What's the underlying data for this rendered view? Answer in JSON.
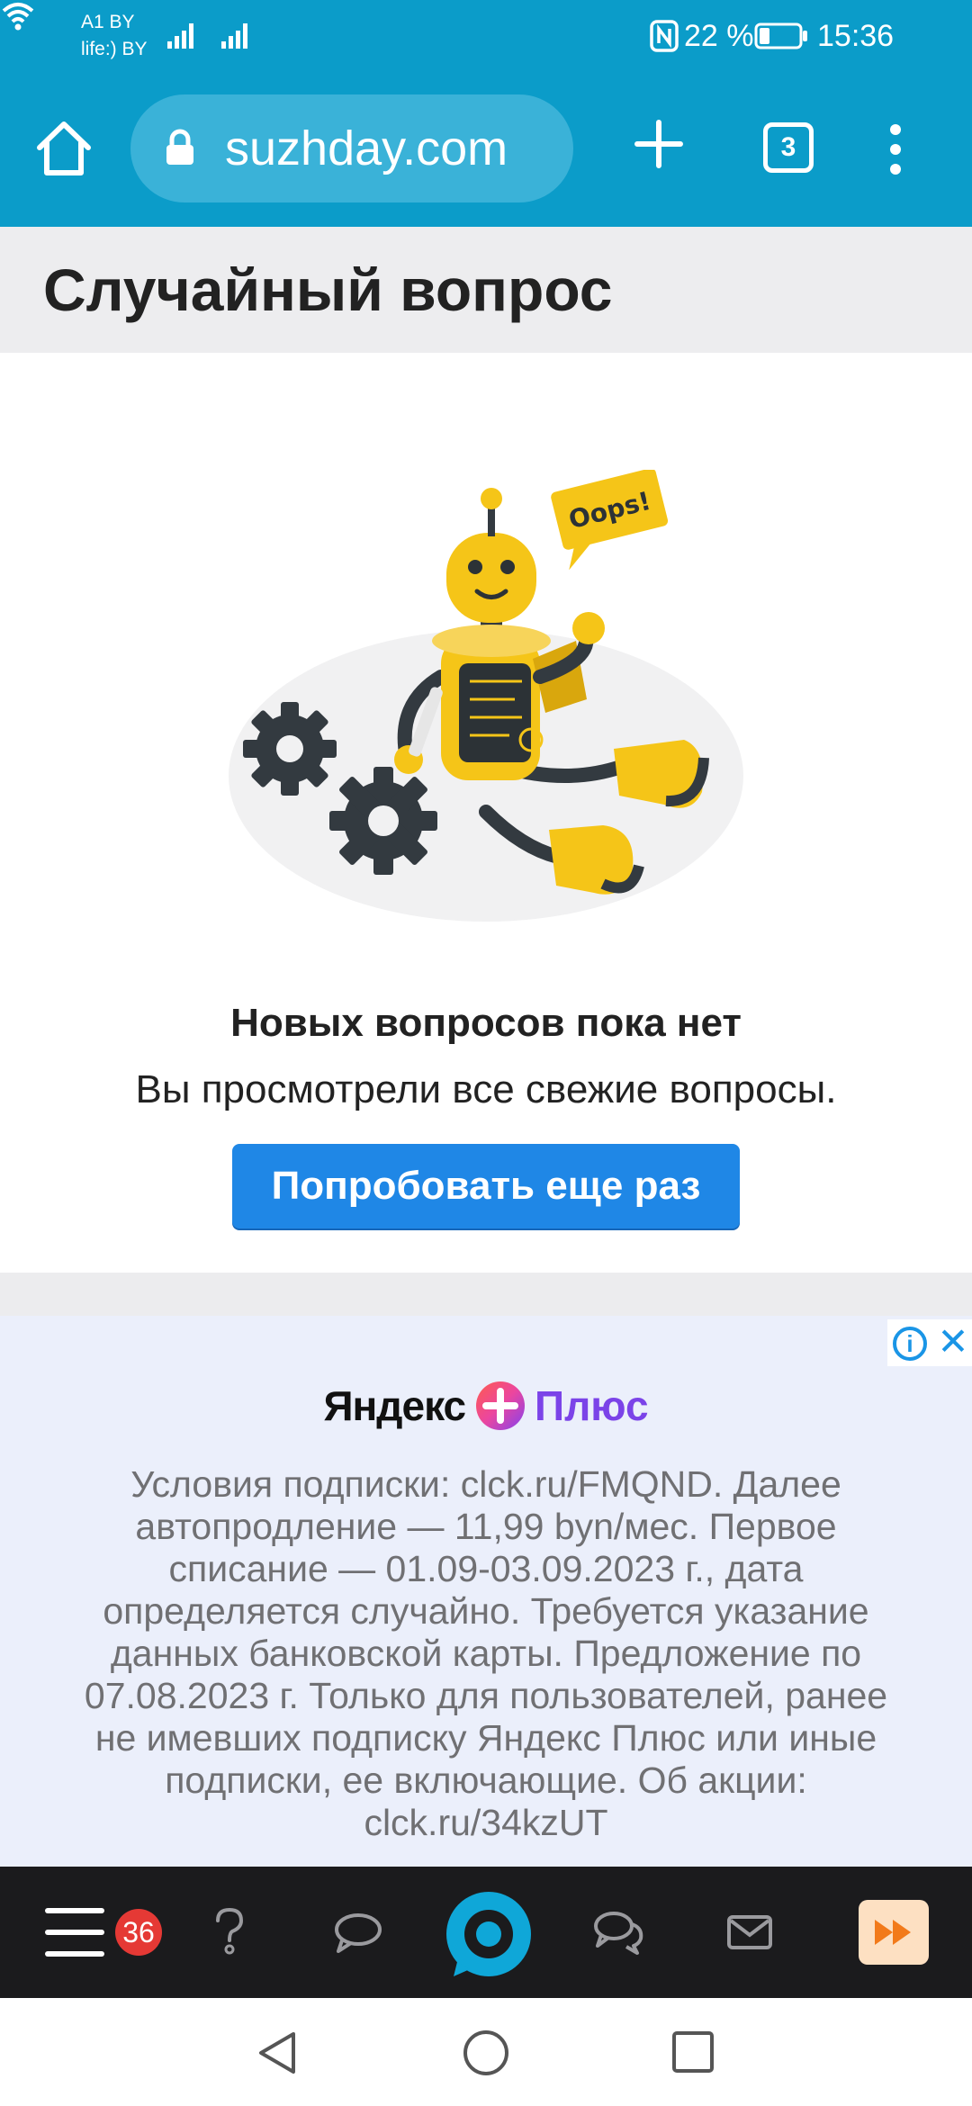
{
  "status_bar": {
    "carrier_1": "A1 BY",
    "carrier_2": "life:) BY",
    "battery_percent": "22 %",
    "time": "15:36"
  },
  "browser": {
    "url": "suzhday.com",
    "tab_count": "3",
    "icons": [
      "home-icon",
      "lock-icon",
      "plus-icon",
      "tabs-icon",
      "more-icon"
    ]
  },
  "page": {
    "title": "Случайный вопрос"
  },
  "empty_state": {
    "illustration_text": "Oops!",
    "title": "Новых вопросов пока нет",
    "subtitle": "Вы просмотрели все свежие вопросы.",
    "retry_button": "Попробовать еще раз"
  },
  "ad": {
    "brand_left": "Яндекс",
    "brand_right": "Плюс",
    "info_icon": "i",
    "close_icon": "✕",
    "text": "Условия подписки: clck.ru/FMQND. Далее автопродление — 11,99 byn/мес. Первое списание — 01.09-03.09.2023 г., дата определяется случайно. Требуется указание данных банковской карты. Предложение по 07.08.2023 г. Только для пользователей, ранее не имевших подписку Яндекс Плюс или иные подписки, ее включающие. Об акции: clck.ru/34kzUT"
  },
  "site_nav": {
    "notification_count": "36",
    "icons": [
      "menu-icon",
      "question-icon",
      "comment-icon",
      "logo-icon",
      "chat-icon",
      "mail-icon",
      "fast-forward-icon"
    ]
  },
  "system_nav": {
    "icons": [
      "back-icon",
      "home-icon",
      "recents-icon"
    ]
  },
  "colors": {
    "accent_blue": "#0b9cc9",
    "button_blue": "#1f87e6",
    "badge_red": "#e53935",
    "robot_yellow": "#f5c518"
  }
}
